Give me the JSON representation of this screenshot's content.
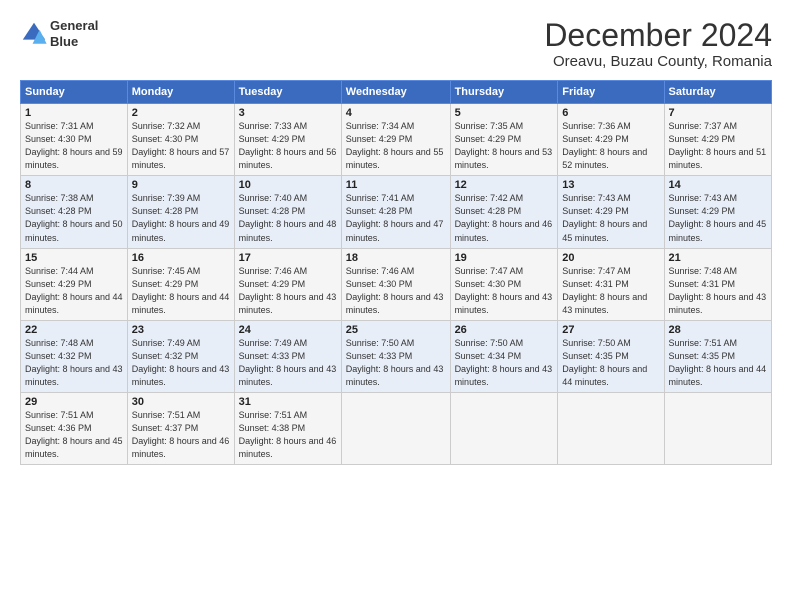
{
  "logo": {
    "line1": "General",
    "line2": "Blue"
  },
  "title": "December 2024",
  "subtitle": "Oreavu, Buzau County, Romania",
  "weekdays": [
    "Sunday",
    "Monday",
    "Tuesday",
    "Wednesday",
    "Thursday",
    "Friday",
    "Saturday"
  ],
  "weeks": [
    [
      {
        "day": "1",
        "sunrise": "Sunrise: 7:31 AM",
        "sunset": "Sunset: 4:30 PM",
        "daylight": "Daylight: 8 hours and 59 minutes."
      },
      {
        "day": "2",
        "sunrise": "Sunrise: 7:32 AM",
        "sunset": "Sunset: 4:30 PM",
        "daylight": "Daylight: 8 hours and 57 minutes."
      },
      {
        "day": "3",
        "sunrise": "Sunrise: 7:33 AM",
        "sunset": "Sunset: 4:29 PM",
        "daylight": "Daylight: 8 hours and 56 minutes."
      },
      {
        "day": "4",
        "sunrise": "Sunrise: 7:34 AM",
        "sunset": "Sunset: 4:29 PM",
        "daylight": "Daylight: 8 hours and 55 minutes."
      },
      {
        "day": "5",
        "sunrise": "Sunrise: 7:35 AM",
        "sunset": "Sunset: 4:29 PM",
        "daylight": "Daylight: 8 hours and 53 minutes."
      },
      {
        "day": "6",
        "sunrise": "Sunrise: 7:36 AM",
        "sunset": "Sunset: 4:29 PM",
        "daylight": "Daylight: 8 hours and 52 minutes."
      },
      {
        "day": "7",
        "sunrise": "Sunrise: 7:37 AM",
        "sunset": "Sunset: 4:29 PM",
        "daylight": "Daylight: 8 hours and 51 minutes."
      }
    ],
    [
      {
        "day": "8",
        "sunrise": "Sunrise: 7:38 AM",
        "sunset": "Sunset: 4:28 PM",
        "daylight": "Daylight: 8 hours and 50 minutes."
      },
      {
        "day": "9",
        "sunrise": "Sunrise: 7:39 AM",
        "sunset": "Sunset: 4:28 PM",
        "daylight": "Daylight: 8 hours and 49 minutes."
      },
      {
        "day": "10",
        "sunrise": "Sunrise: 7:40 AM",
        "sunset": "Sunset: 4:28 PM",
        "daylight": "Daylight: 8 hours and 48 minutes."
      },
      {
        "day": "11",
        "sunrise": "Sunrise: 7:41 AM",
        "sunset": "Sunset: 4:28 PM",
        "daylight": "Daylight: 8 hours and 47 minutes."
      },
      {
        "day": "12",
        "sunrise": "Sunrise: 7:42 AM",
        "sunset": "Sunset: 4:28 PM",
        "daylight": "Daylight: 8 hours and 46 minutes."
      },
      {
        "day": "13",
        "sunrise": "Sunrise: 7:43 AM",
        "sunset": "Sunset: 4:29 PM",
        "daylight": "Daylight: 8 hours and 45 minutes."
      },
      {
        "day": "14",
        "sunrise": "Sunrise: 7:43 AM",
        "sunset": "Sunset: 4:29 PM",
        "daylight": "Daylight: 8 hours and 45 minutes."
      }
    ],
    [
      {
        "day": "15",
        "sunrise": "Sunrise: 7:44 AM",
        "sunset": "Sunset: 4:29 PM",
        "daylight": "Daylight: 8 hours and 44 minutes."
      },
      {
        "day": "16",
        "sunrise": "Sunrise: 7:45 AM",
        "sunset": "Sunset: 4:29 PM",
        "daylight": "Daylight: 8 hours and 44 minutes."
      },
      {
        "day": "17",
        "sunrise": "Sunrise: 7:46 AM",
        "sunset": "Sunset: 4:29 PM",
        "daylight": "Daylight: 8 hours and 43 minutes."
      },
      {
        "day": "18",
        "sunrise": "Sunrise: 7:46 AM",
        "sunset": "Sunset: 4:30 PM",
        "daylight": "Daylight: 8 hours and 43 minutes."
      },
      {
        "day": "19",
        "sunrise": "Sunrise: 7:47 AM",
        "sunset": "Sunset: 4:30 PM",
        "daylight": "Daylight: 8 hours and 43 minutes."
      },
      {
        "day": "20",
        "sunrise": "Sunrise: 7:47 AM",
        "sunset": "Sunset: 4:31 PM",
        "daylight": "Daylight: 8 hours and 43 minutes."
      },
      {
        "day": "21",
        "sunrise": "Sunrise: 7:48 AM",
        "sunset": "Sunset: 4:31 PM",
        "daylight": "Daylight: 8 hours and 43 minutes."
      }
    ],
    [
      {
        "day": "22",
        "sunrise": "Sunrise: 7:48 AM",
        "sunset": "Sunset: 4:32 PM",
        "daylight": "Daylight: 8 hours and 43 minutes."
      },
      {
        "day": "23",
        "sunrise": "Sunrise: 7:49 AM",
        "sunset": "Sunset: 4:32 PM",
        "daylight": "Daylight: 8 hours and 43 minutes."
      },
      {
        "day": "24",
        "sunrise": "Sunrise: 7:49 AM",
        "sunset": "Sunset: 4:33 PM",
        "daylight": "Daylight: 8 hours and 43 minutes."
      },
      {
        "day": "25",
        "sunrise": "Sunrise: 7:50 AM",
        "sunset": "Sunset: 4:33 PM",
        "daylight": "Daylight: 8 hours and 43 minutes."
      },
      {
        "day": "26",
        "sunrise": "Sunrise: 7:50 AM",
        "sunset": "Sunset: 4:34 PM",
        "daylight": "Daylight: 8 hours and 43 minutes."
      },
      {
        "day": "27",
        "sunrise": "Sunrise: 7:50 AM",
        "sunset": "Sunset: 4:35 PM",
        "daylight": "Daylight: 8 hours and 44 minutes."
      },
      {
        "day": "28",
        "sunrise": "Sunrise: 7:51 AM",
        "sunset": "Sunset: 4:35 PM",
        "daylight": "Daylight: 8 hours and 44 minutes."
      }
    ],
    [
      {
        "day": "29",
        "sunrise": "Sunrise: 7:51 AM",
        "sunset": "Sunset: 4:36 PM",
        "daylight": "Daylight: 8 hours and 45 minutes."
      },
      {
        "day": "30",
        "sunrise": "Sunrise: 7:51 AM",
        "sunset": "Sunset: 4:37 PM",
        "daylight": "Daylight: 8 hours and 46 minutes."
      },
      {
        "day": "31",
        "sunrise": "Sunrise: 7:51 AM",
        "sunset": "Sunset: 4:38 PM",
        "daylight": "Daylight: 8 hours and 46 minutes."
      },
      null,
      null,
      null,
      null
    ]
  ]
}
